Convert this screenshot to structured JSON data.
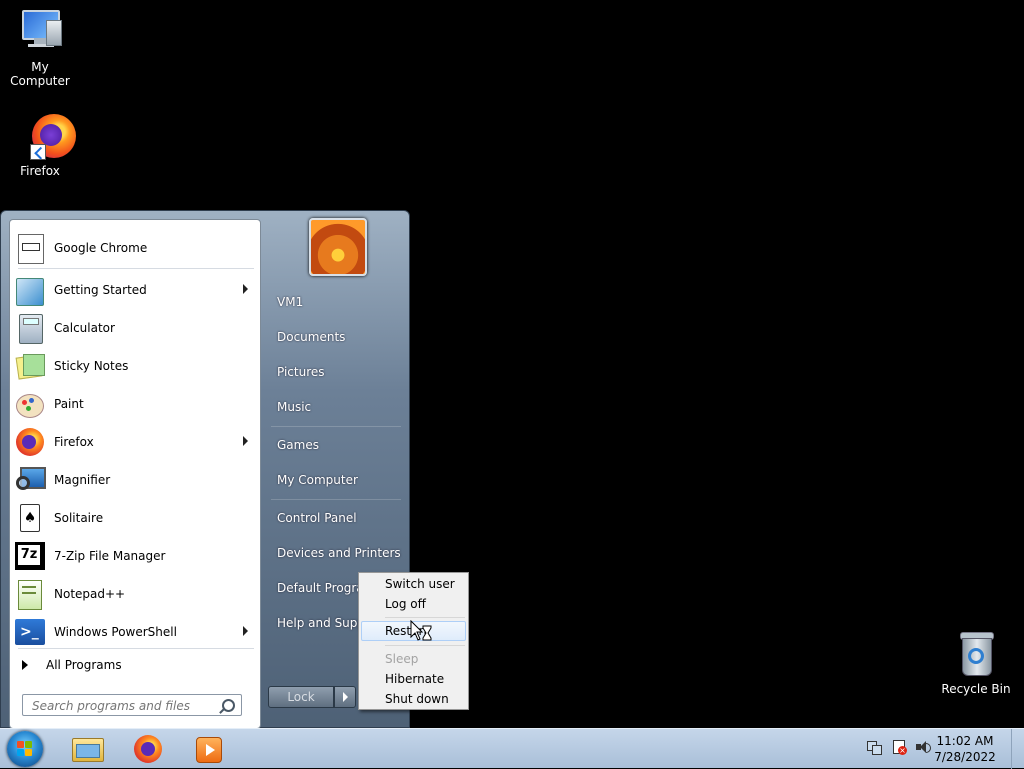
{
  "desktop": {
    "icons": [
      {
        "label": "My Computer",
        "icon": "computer-icon"
      },
      {
        "label": "Firefox",
        "icon": "firefox-icon"
      },
      {
        "label": "Recycle Bin",
        "icon": "recycle-bin-icon"
      }
    ]
  },
  "start_menu": {
    "programs": [
      {
        "label": "Google Chrome",
        "icon": "chrome-icon",
        "submenu": false
      },
      {
        "label": "Getting Started",
        "icon": "getting-started-icon",
        "submenu": true
      },
      {
        "label": "Calculator",
        "icon": "calculator-icon",
        "submenu": false
      },
      {
        "label": "Sticky Notes",
        "icon": "sticky-notes-icon",
        "submenu": false
      },
      {
        "label": "Paint",
        "icon": "paint-icon",
        "submenu": false
      },
      {
        "label": "Firefox",
        "icon": "firefox-icon",
        "submenu": true
      },
      {
        "label": "Magnifier",
        "icon": "magnifier-icon",
        "submenu": false
      },
      {
        "label": "Solitaire",
        "icon": "solitaire-icon",
        "submenu": false
      },
      {
        "label": "7-Zip File Manager",
        "icon": "7zip-icon",
        "submenu": false
      },
      {
        "label": "Notepad++",
        "icon": "notepadpp-icon",
        "submenu": false
      },
      {
        "label": "Windows PowerShell",
        "icon": "powershell-icon",
        "submenu": true
      }
    ],
    "all_programs": "All Programs",
    "search_placeholder": "Search programs and files",
    "right_items": [
      {
        "label": "VM1"
      },
      {
        "label": "Documents"
      },
      {
        "label": "Pictures"
      },
      {
        "label": "Music"
      },
      {
        "label": "Games"
      },
      {
        "label": "My Computer"
      },
      {
        "label": "Control Panel"
      },
      {
        "label": "Devices and Printers"
      },
      {
        "label": "Default Programs"
      },
      {
        "label": "Help and Support"
      }
    ],
    "power_button": "Lock"
  },
  "power_menu": {
    "items": [
      {
        "label": "Switch user",
        "state": "normal"
      },
      {
        "label": "Log off",
        "state": "normal"
      },
      {
        "label": "Restart",
        "state": "hover"
      },
      {
        "label": "Sleep",
        "state": "disabled"
      },
      {
        "label": "Hibernate",
        "state": "normal"
      },
      {
        "label": "Shut down",
        "state": "normal"
      }
    ]
  },
  "taskbar": {
    "pinned": [
      "explorer-icon",
      "firefox-icon",
      "media-player-icon"
    ],
    "tray": [
      "network-icon",
      "action-center-icon",
      "volume-icon"
    ],
    "time": "11:02 AM",
    "date": "7/28/2022"
  },
  "colors": {
    "desktop_bg": "#000000",
    "taskbar": "#b8cbe2",
    "start_menu": "#5a6d82"
  }
}
